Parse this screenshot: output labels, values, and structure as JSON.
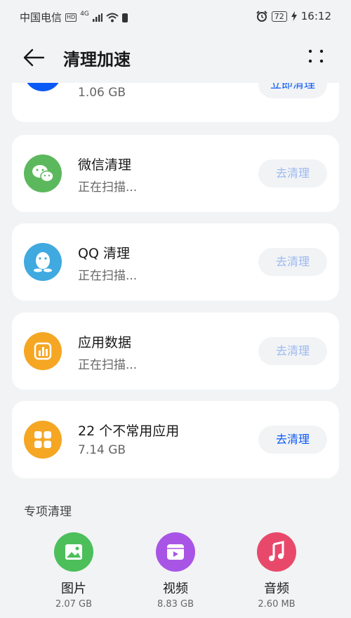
{
  "status_bar": {
    "carrier": "中国电信",
    "hd": "HD",
    "network": "4G",
    "battery": "72",
    "time": "16:12"
  },
  "app_bar": {
    "title": "清理加速"
  },
  "top_card": {
    "size": "1.06 GB",
    "button": "立即清理"
  },
  "cards": [
    {
      "title": "微信清理",
      "subtitle": "正在扫描...",
      "button": "去清理",
      "icon": "wechat-icon",
      "color": "#5cb85c"
    },
    {
      "title": "QQ 清理",
      "subtitle": "正在扫描...",
      "button": "去清理",
      "icon": "qq-icon",
      "color": "#3fa9e0"
    },
    {
      "title": "应用数据",
      "subtitle": "正在扫描...",
      "button": "去清理",
      "icon": "app-data-icon",
      "color": "#f5a623"
    },
    {
      "title": "22 个不常用应用",
      "subtitle": "7.14 GB",
      "button": "去清理",
      "icon": "apps-grid-icon",
      "color": "#f5a623"
    }
  ],
  "special_section": {
    "title": "专项清理",
    "items": [
      {
        "label": "图片",
        "size": "2.07 GB",
        "icon": "image-icon",
        "color": "#4cbf5a"
      },
      {
        "label": "视频",
        "size": "8.83 GB",
        "icon": "video-icon",
        "color": "#a855e6"
      },
      {
        "label": "音频",
        "size": "2.60 MB",
        "icon": "music-icon",
        "color": "#e8496b"
      }
    ]
  },
  "colors": {
    "accent": "#0a59f7",
    "background": "#f1f3f5"
  }
}
